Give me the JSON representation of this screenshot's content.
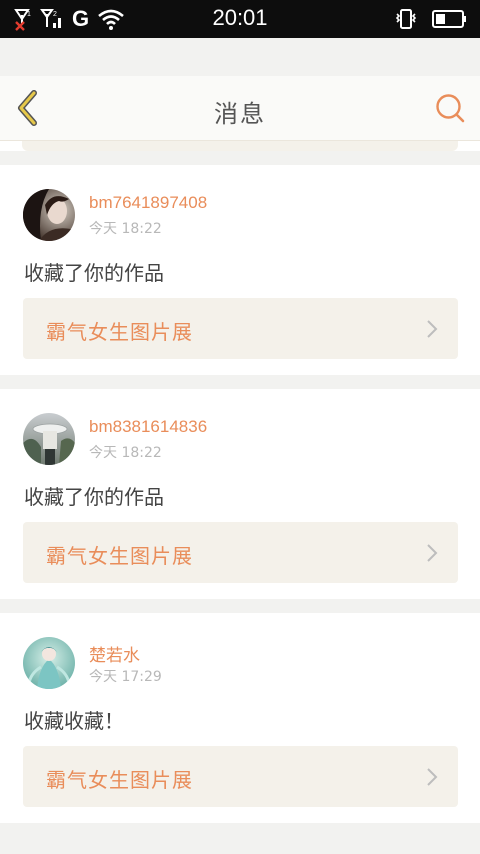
{
  "status_bar": {
    "carrier": "G",
    "time": "20:01"
  },
  "header": {
    "title": "消息",
    "accent_color": "#e98d5a",
    "back_icon_color": "#e6c84a"
  },
  "messages": [
    {
      "username": "bm7641897408",
      "time": "今天 18:22",
      "message": "收藏了你的作品",
      "work_title": "霸气女生图片展",
      "avatar": "dark-portrait-avatar"
    },
    {
      "username": "bm8381614836",
      "time": "今天 18:22",
      "message": "收藏了你的作品",
      "work_title": "霸气女生图片展",
      "avatar": "hat-figure-avatar"
    },
    {
      "username": "楚若水",
      "time": "今天 17:29",
      "message": "收藏收藏！",
      "work_title": "霸气女生图片展",
      "avatar": "teal-anime-avatar"
    }
  ]
}
